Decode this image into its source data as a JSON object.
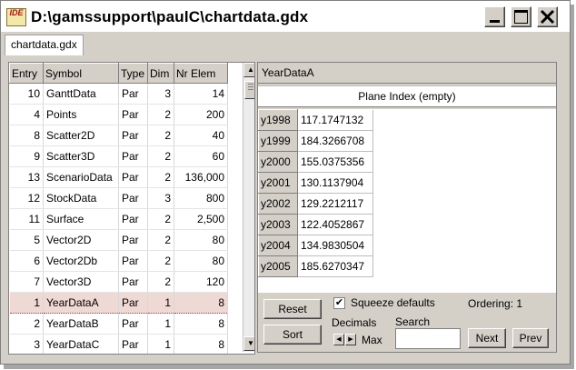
{
  "window": {
    "title": "D:\\gamssupport\\paulC\\chartdata.gdx",
    "logo_text": "IDE",
    "controls": {
      "minimize": "minimize-icon",
      "maximize": "maximize-icon",
      "close": "close-icon"
    }
  },
  "tabs": [
    {
      "label": "chartdata.gdx",
      "active": true
    }
  ],
  "symbols": {
    "columns": [
      "Entry",
      "Symbol",
      "Type",
      "Dim",
      "Nr Elem"
    ],
    "rows": [
      {
        "entry": "10",
        "symbol": "GanttData",
        "type": "Par",
        "dim": "3",
        "nr": "14"
      },
      {
        "entry": "4",
        "symbol": "Points",
        "type": "Par",
        "dim": "2",
        "nr": "200"
      },
      {
        "entry": "8",
        "symbol": "Scatter2D",
        "type": "Par",
        "dim": "2",
        "nr": "40"
      },
      {
        "entry": "9",
        "symbol": "Scatter3D",
        "type": "Par",
        "dim": "2",
        "nr": "60"
      },
      {
        "entry": "13",
        "symbol": "ScenarioData",
        "type": "Par",
        "dim": "2",
        "nr": "136,000"
      },
      {
        "entry": "12",
        "symbol": "StockData",
        "type": "Par",
        "dim": "3",
        "nr": "800"
      },
      {
        "entry": "11",
        "symbol": "Surface",
        "type": "Par",
        "dim": "2",
        "nr": "2,500"
      },
      {
        "entry": "5",
        "symbol": "Vector2D",
        "type": "Par",
        "dim": "2",
        "nr": "80"
      },
      {
        "entry": "6",
        "symbol": "Vector2Db",
        "type": "Par",
        "dim": "2",
        "nr": "80"
      },
      {
        "entry": "7",
        "symbol": "Vector3D",
        "type": "Par",
        "dim": "2",
        "nr": "120"
      },
      {
        "entry": "1",
        "symbol": "YearDataA",
        "type": "Par",
        "dim": "1",
        "nr": "8",
        "selected": true
      },
      {
        "entry": "2",
        "symbol": "YearDataB",
        "type": "Par",
        "dim": "1",
        "nr": "8"
      },
      {
        "entry": "3",
        "symbol": "YearDataC",
        "type": "Par",
        "dim": "1",
        "nr": "8"
      }
    ]
  },
  "detail": {
    "symbol_name": "YearDataA",
    "plane_index": "Plane Index (empty)",
    "rows": [
      {
        "key": "y1998",
        "value": "117.1747132"
      },
      {
        "key": "y1999",
        "value": "184.3266708"
      },
      {
        "key": "y2000",
        "value": "155.0375356"
      },
      {
        "key": "y2001",
        "value": "130.1137904"
      },
      {
        "key": "y2002",
        "value": "129.2212117"
      },
      {
        "key": "y2003",
        "value": "122.4052867"
      },
      {
        "key": "y2004",
        "value": "134.9830504"
      },
      {
        "key": "y2005",
        "value": "185.6270347"
      }
    ]
  },
  "controls": {
    "reset_label": "Reset",
    "sort_label": "Sort",
    "squeeze_label": "Squeeze defaults",
    "squeeze_checked": true,
    "ordering_label": "Ordering: 1",
    "decimals_label": "Decimals",
    "max_label": "Max",
    "search_label": "Search",
    "search_value": "",
    "next_label": "Next",
    "prev_label": "Prev"
  },
  "colors": {
    "selection": "#efd9d4",
    "face": "#d4d0c8",
    "close_accent": "#b01010"
  }
}
